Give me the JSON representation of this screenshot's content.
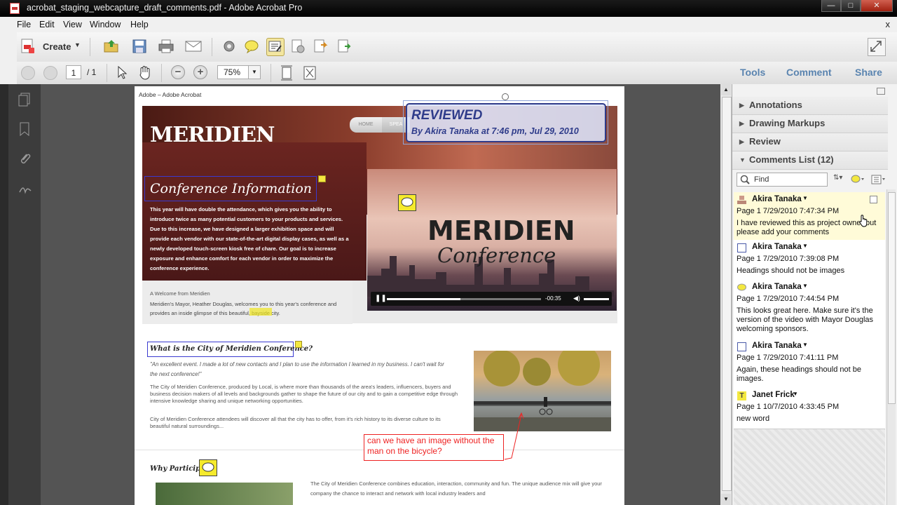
{
  "window": {
    "title": "acrobat_staging_webcapture_draft_comments.pdf - Adobe Acrobat Pro",
    "minimize": "—",
    "maximize": "□",
    "close": "✕"
  },
  "menu": {
    "items": [
      "File",
      "Edit",
      "View",
      "Window",
      "Help"
    ],
    "close": "x"
  },
  "toolbar": {
    "create_label": "Create"
  },
  "nav": {
    "page_current": "1",
    "page_total": "/ 1",
    "zoom": "75%",
    "tabs": [
      "Tools",
      "Comment",
      "Share"
    ]
  },
  "panel": {
    "sections": [
      "Annotations",
      "Drawing Markups",
      "Review"
    ],
    "comments_list_title": "Comments List (12)",
    "find_placeholder": "Find",
    "comments": [
      {
        "author": "Akira Tanaka",
        "meta": "Page 1  7/29/2010 7:47:34 PM",
        "body": "I have reviewed this as project owner but please add your comments",
        "icon": "stamp-icon",
        "selected": true
      },
      {
        "author": "Akira Tanaka",
        "meta": "Page 1  7/29/2010 7:39:08 PM",
        "body": "Headings should not be images",
        "icon": "rectangle-icon"
      },
      {
        "author": "Akira Tanaka",
        "meta": "Page 1  7/29/2010 7:44:54 PM",
        "body": "This looks great here. Make sure it's the version of the video with Mayor Douglas welcoming sponsors.",
        "icon": "sticky-note-icon"
      },
      {
        "author": "Akira Tanaka",
        "meta": "Page 1  7/29/2010 7:41:11 PM",
        "body": "Again, these headings should not be images.",
        "icon": "rectangle-icon"
      },
      {
        "author": "Janet Frick",
        "meta": "Page 1  10/7/2010 4:33:45 PM",
        "body": "new word",
        "icon": "text-insert-icon"
      }
    ]
  },
  "doc": {
    "site_header": "Adobe – Adobe Acrobat",
    "stamp": {
      "title": "REVIEWED",
      "sub": "By Akira Tanaka at 7:46 pm, Jul 29, 2010"
    },
    "logo_main": "MERIDIEN",
    "logo_sub": "Conference",
    "nav_items": [
      "HOME",
      "SPEA"
    ],
    "intro_heading": "Conference Information",
    "intro_text": "This year will have double the attendance, which gives you the ability to introduce twice as many potential customers to your products and services. Due to this increase, we have designed a larger exhibition space and will provide each vendor with our state-of-the-art digital display cases, as well as a newly developed touch-screen kiosk free of chare. Our goal is to increase exposure and enhance comfort for each vendor in order to maximize the conference experience.",
    "welcome_title": "A Welcome from Meridien",
    "welcome_text": "Meridien's Mayor, Heather Douglas, welcomes you to this year's conference and provides an inside glimpse of this beautiful, bayside city.",
    "video_time": "-00:35",
    "city_heading": "What is the City of Meridien Conference?",
    "quote": "\"An excellent event. I made a lot of new contacts and I plan to use the information I learned in my business. I can't wait for the next conference!\"",
    "city_p1": "The City of Meridien Conference, produced by Local, is where more than thousands of the area's leaders, influencers, buyers and business decision makers of all levels and backgrounds gather to shape the future of our city and to gain a competitive edge through intensive knowledge sharing and unique networking opportunities.",
    "city_p2": "City of Meridien Conference attendees will discover all that the city has to offer, from it's rich history to its diverse culture to its beautiful natural surroundings...",
    "callout": "can we have an image without the man on the bicycle?",
    "why_heading": "Why Participa",
    "bottom_text": "The City of Meridien Conference combines education, interaction, community and fun. The unique audience mix will give your company the chance to interact and network with local industry leaders and"
  }
}
